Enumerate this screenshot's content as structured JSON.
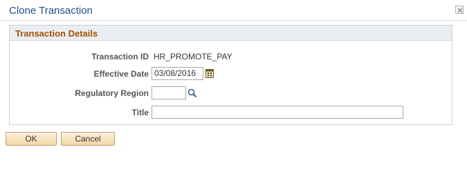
{
  "dialog": {
    "title": "Clone Transaction",
    "close_icon": "close-icon"
  },
  "group": {
    "title": "Transaction Details"
  },
  "fields": {
    "transaction_id_label": "Transaction ID",
    "transaction_id_value": "HR_PROMOTE_PAY",
    "effective_date_label": "Effective Date",
    "effective_date_value": "03/08/2016",
    "regulatory_region_label": "Regulatory Region",
    "regulatory_region_value": "",
    "title_label": "Title",
    "title_value": ""
  },
  "icons": {
    "calendar": "calendar-icon",
    "lookup": "search-icon"
  },
  "buttons": {
    "ok_label": "OK",
    "cancel_label": "Cancel"
  },
  "colors": {
    "title_blue": "#204f8a",
    "group_title_orange": "#a94e00",
    "button_gradient_top": "#fdf1dd",
    "button_gradient_bottom": "#f5d6a4"
  }
}
